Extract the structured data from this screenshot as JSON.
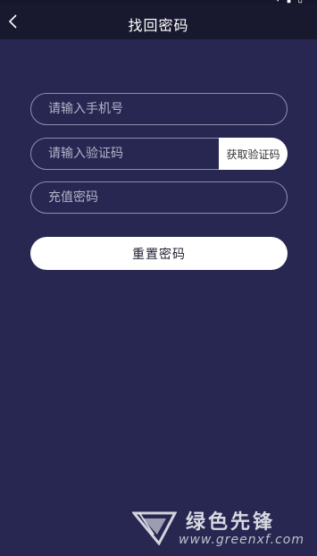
{
  "header": {
    "title": "找回密码",
    "back_icon": "chevron-left-icon"
  },
  "status_bar": {
    "icons": "▾ ▮ ▯"
  },
  "form": {
    "phone_placeholder": "请输入手机号",
    "code_placeholder": "请输入验证码",
    "get_code_label": "获取验证码",
    "password_placeholder": "充值密码",
    "submit_label": "重置密码"
  },
  "watermark": {
    "name": "绿色先锋",
    "url": "www.greenxf.com"
  },
  "colors": {
    "background": "#272752",
    "header": "#18182f",
    "field_border": "#8f8fae",
    "button": "#ffffff"
  }
}
